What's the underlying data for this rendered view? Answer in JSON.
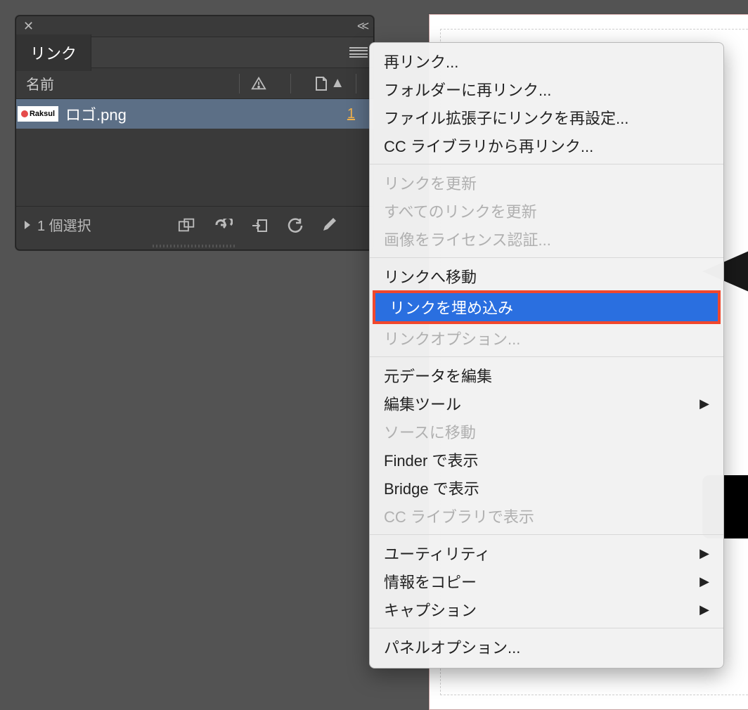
{
  "panel": {
    "tab_label": "リンク",
    "column_name": "名前",
    "row": {
      "thumb_text": "Raksul",
      "filename": "ロゴ.png",
      "count": "1"
    },
    "selection_label": "1 個選択"
  },
  "menu": {
    "items": [
      {
        "label": "再リンク...",
        "disabled": false,
        "submenu": false
      },
      {
        "label": "フォルダーに再リンク...",
        "disabled": false,
        "submenu": false
      },
      {
        "label": "ファイル拡張子にリンクを再設定...",
        "disabled": false,
        "submenu": false
      },
      {
        "label": "CC ライブラリから再リンク...",
        "disabled": false,
        "submenu": false
      },
      {
        "sep": true
      },
      {
        "label": "リンクを更新",
        "disabled": true,
        "submenu": false
      },
      {
        "label": "すべてのリンクを更新",
        "disabled": true,
        "submenu": false
      },
      {
        "label": "画像をライセンス認証...",
        "disabled": true,
        "submenu": false
      },
      {
        "sep": true
      },
      {
        "label": "リンクへ移動",
        "disabled": false,
        "submenu": false
      },
      {
        "label": "リンクを埋め込み",
        "disabled": false,
        "submenu": false,
        "highlight": true
      },
      {
        "label": "リンクオプション...",
        "disabled": true,
        "submenu": false
      },
      {
        "sep": true
      },
      {
        "label": "元データを編集",
        "disabled": false,
        "submenu": false
      },
      {
        "label": "編集ツール",
        "disabled": false,
        "submenu": true
      },
      {
        "label": "ソースに移動",
        "disabled": true,
        "submenu": false
      },
      {
        "label": "Finder で表示",
        "disabled": false,
        "submenu": false
      },
      {
        "label": "Bridge で表示",
        "disabled": false,
        "submenu": false
      },
      {
        "label": "CC ライブラリで表示",
        "disabled": true,
        "submenu": false
      },
      {
        "sep": true
      },
      {
        "label": "ユーティリティ",
        "disabled": false,
        "submenu": true
      },
      {
        "label": "情報をコピー",
        "disabled": false,
        "submenu": true
      },
      {
        "label": "キャプション",
        "disabled": false,
        "submenu": true
      },
      {
        "sep": true
      },
      {
        "label": "パネルオプション...",
        "disabled": false,
        "submenu": false
      }
    ]
  }
}
